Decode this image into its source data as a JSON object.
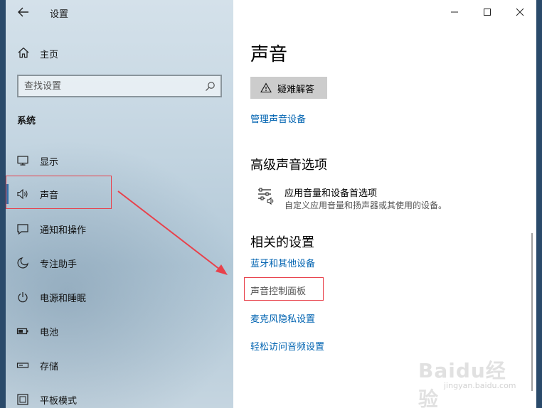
{
  "window": {
    "title": "设置"
  },
  "sidebar": {
    "home_label": "主页",
    "search_placeholder": "查找设置",
    "section_title": "系统",
    "items": [
      {
        "label": "显示",
        "icon": "monitor-icon"
      },
      {
        "label": "声音",
        "icon": "speaker-icon",
        "active": true
      },
      {
        "label": "通知和操作",
        "icon": "notification-icon"
      },
      {
        "label": "专注助手",
        "icon": "moon-icon"
      },
      {
        "label": "电源和睡眠",
        "icon": "power-icon"
      },
      {
        "label": "电池",
        "icon": "battery-icon"
      },
      {
        "label": "存储",
        "icon": "storage-icon"
      },
      {
        "label": "平板模式",
        "icon": "tablet-icon"
      }
    ]
  },
  "content": {
    "page_title": "声音",
    "troubleshoot_label": "疑难解答",
    "manage_devices_link": "管理声音设备",
    "advanced_heading": "高级声音选项",
    "app_volume": {
      "title": "应用音量和设备首选项",
      "description": "自定义应用音量和扬声器或其使用的设备。"
    },
    "related_heading": "相关的设置",
    "related_links": {
      "bluetooth": "蓝牙和其他设备",
      "control_panel": "声音控制面板",
      "mic_privacy": "麦克风隐私设置",
      "ease_of_access": "轻松访问音频设置"
    }
  },
  "watermark": {
    "brand": "Baidu经验",
    "url": "jingyan.baidu.com"
  },
  "colors": {
    "link": "#0063b1",
    "annotation": "#e8414b",
    "accent_bar": "#3070a8"
  }
}
